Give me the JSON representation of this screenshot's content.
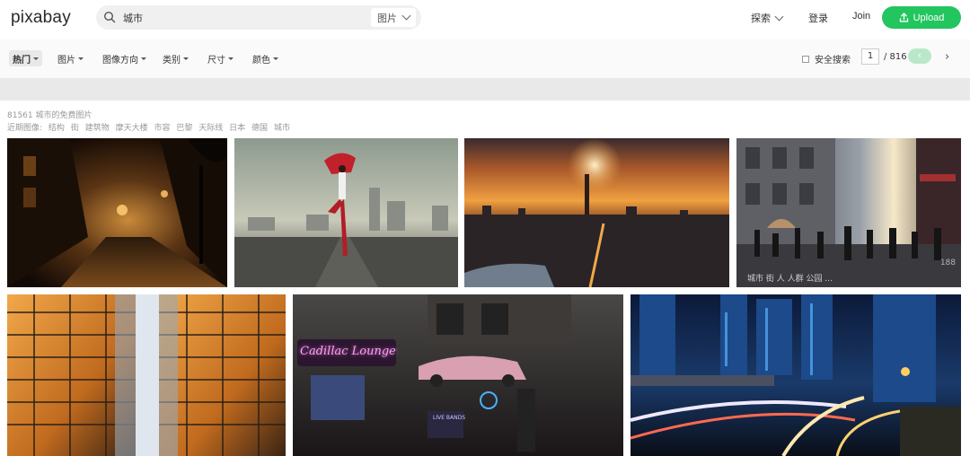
{
  "header": {
    "logo": "pixabay",
    "search_value": "城市",
    "search_type": "图片",
    "explore": "探索",
    "login": "登录",
    "join": "Join",
    "upload": "Upload"
  },
  "filters": {
    "items": [
      {
        "label": "热门"
      },
      {
        "label": "图片"
      },
      {
        "label": "图像方向"
      },
      {
        "label": "类别"
      },
      {
        "label": "尺寸"
      },
      {
        "label": "颜色"
      }
    ],
    "safe_search": "安全搜索",
    "page": "1",
    "page_total": "/ 816",
    "prev": "‹",
    "next": "›"
  },
  "results": {
    "count": "81561 城市的免费图片",
    "related_label": "近期图像:",
    "related": [
      "结构",
      "街",
      "建筑物",
      "摩天大楼",
      "市容",
      "巴黎",
      "天际线",
      "日本",
      "德国",
      "城市"
    ]
  },
  "photos": [
    {
      "id": "night-alley"
    },
    {
      "id": "dancer-city"
    },
    {
      "id": "sunset-skyline"
    },
    {
      "id": "busy-street",
      "tags": "城市  街  人  人群  公园  ...",
      "count": "188"
    },
    {
      "id": "glass-towers"
    },
    {
      "id": "neon-storefront",
      "sign": "Cadillac Lounge",
      "sign2": "LIVE BANDS"
    },
    {
      "id": "light-trails"
    }
  ],
  "colors": {
    "accent": "#22c55e",
    "accent_light": "#b9e8c9"
  }
}
